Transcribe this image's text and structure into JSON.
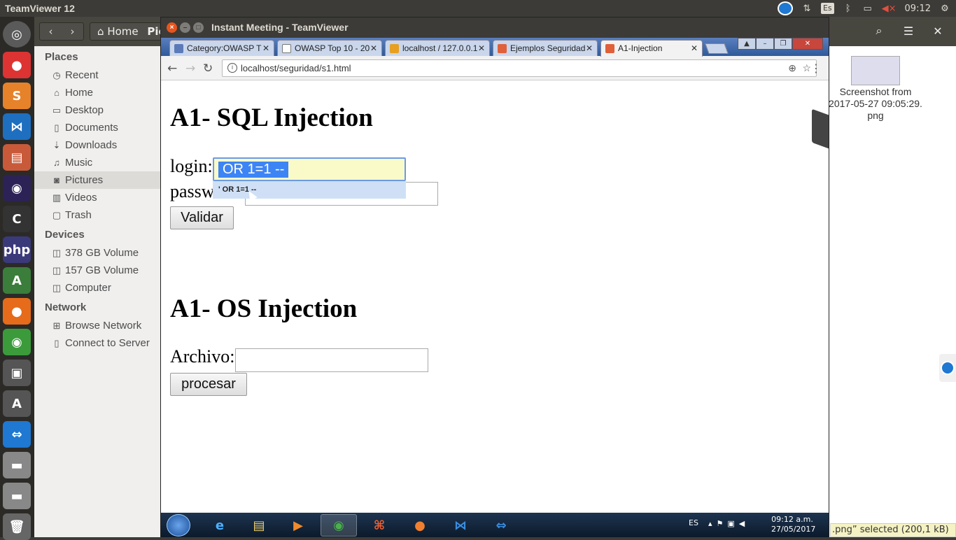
{
  "top_panel": {
    "app_title": "TeamViewer 12",
    "keyboard": "Es",
    "time": "09:12"
  },
  "launcher": {
    "items": [
      "ubuntu-dash",
      "tomato",
      "sublime",
      "vscode",
      "files",
      "eclipse",
      "cdt",
      "php",
      "android",
      "firefox",
      "chrome",
      "screen",
      "software",
      "teamviewer",
      "disk1",
      "disk2",
      "trash"
    ]
  },
  "nautilus": {
    "back": "‹",
    "forward": "›",
    "breadcrumb_home": "Home",
    "breadcrumb_current": "Pict",
    "sidebar": {
      "places_heading": "Places",
      "places": [
        {
          "icon": "recent-icon",
          "label": "Recent"
        },
        {
          "icon": "home-icon",
          "label": "Home"
        },
        {
          "icon": "folder-icon",
          "label": "Desktop"
        },
        {
          "icon": "document-icon",
          "label": "Documents"
        },
        {
          "icon": "download-icon",
          "label": "Downloads"
        },
        {
          "icon": "music-icon",
          "label": "Music"
        },
        {
          "icon": "camera-icon",
          "label": "Pictures"
        },
        {
          "icon": "film-icon",
          "label": "Videos"
        },
        {
          "icon": "trash-icon",
          "label": "Trash"
        }
      ],
      "devices_heading": "Devices",
      "devices": [
        {
          "icon": "drive-icon",
          "label": "378 GB Volume"
        },
        {
          "icon": "drive-icon",
          "label": "157 GB Volume"
        },
        {
          "icon": "drive-icon",
          "label": "Computer"
        }
      ],
      "network_heading": "Network",
      "network": [
        {
          "icon": "network-icon",
          "label": "Browse Network"
        },
        {
          "icon": "server-icon",
          "label": "Connect to Server"
        }
      ]
    },
    "file": {
      "label": "Screenshot from 2017-05-27 09:05:29. png"
    },
    "status": ".png” selected  (200,1 kB)"
  },
  "teamviewer": {
    "title": "Instant Meeting - TeamViewer"
  },
  "browser": {
    "tabs": [
      {
        "label": "Category:OWASP T",
        "color": "#5b7ab8"
      },
      {
        "label": "OWASP Top 10 - 20",
        "color": "#ffffff"
      },
      {
        "label": "localhost / 127.0.0.1",
        "color": "#e8a020"
      },
      {
        "label": "Ejemplos Seguridad",
        "color": "#e0603a"
      },
      {
        "label": "A1-Injection",
        "color": "#e0603a"
      }
    ],
    "url": "localhost/seguridad/s1.html"
  },
  "page": {
    "sql_heading": "A1- SQL Injection",
    "login_label": "login:",
    "login_value": "' OR 1=1 --",
    "login_selected": "OR 1=1 --",
    "password_label": "passw",
    "autocomplete": "' OR 1=1 --",
    "validar_button": "Validar",
    "os_heading": "A1- OS Injection",
    "archivo_label": "Archivo:",
    "procesar_button": "procesar"
  },
  "taskbar": {
    "lang": "ES",
    "time": "09:12 a.m.",
    "date": "27/05/2017"
  }
}
